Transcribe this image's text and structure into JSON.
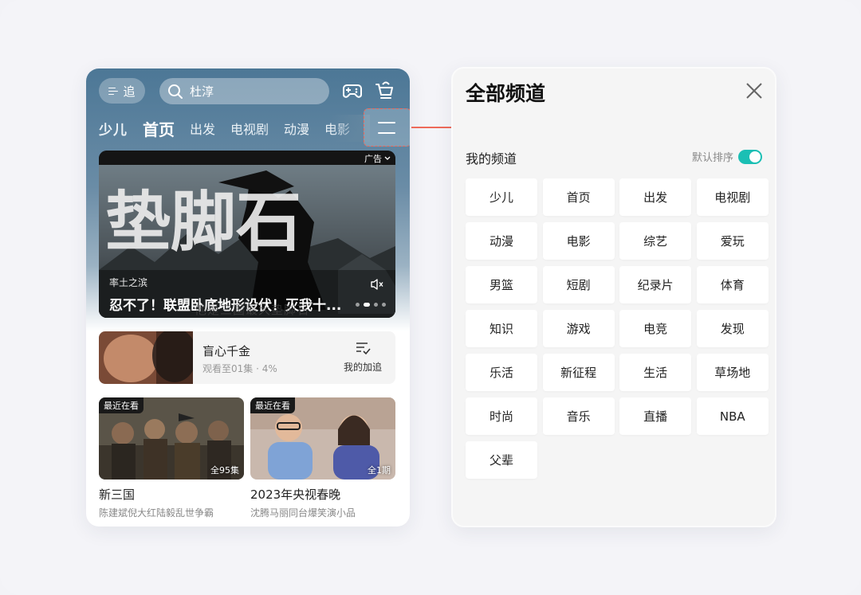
{
  "colors": {
    "accent_red": "#ee6a5a",
    "toggle_teal": "#1bbfb4",
    "header_blue": "#4c7796"
  },
  "phone": {
    "follow_label": "追",
    "search_placeholder": "杜淳",
    "icons": [
      "gamepad-icon",
      "cart-icon",
      "menu-icon",
      "search-icon"
    ],
    "tabs": [
      {
        "label": "少儿",
        "active": false
      },
      {
        "label": "首页",
        "active": true
      },
      {
        "label": "出发",
        "active": false
      },
      {
        "label": "电视剧",
        "active": false
      },
      {
        "label": "动漫",
        "active": false
      },
      {
        "label": "电影",
        "active": false
      }
    ],
    "banner": {
      "ad_label": "广告",
      "calligraphy": "垫脚石",
      "subtitle": "率土之滨",
      "title": "忍不了！联盟卧底地形设伏！灭我十...",
      "caption": "他是三国最大垫脚石"
    },
    "continue_watching": {
      "title": "盲心千金",
      "meta": "观看至01集 · 4%",
      "progress_percent": 4,
      "fav_label": "我的加追"
    },
    "cards": [
      {
        "tag": "最近在看",
        "episodes": "全95集",
        "title": "新三国",
        "subtitle": "陈建斌倪大红陆毅乱世争霸"
      },
      {
        "tag": "最近在看",
        "episodes": "全1期",
        "title": "2023年央视春晚",
        "subtitle": "沈腾马丽同台爆笑演小品"
      }
    ]
  },
  "panel": {
    "title": "全部频道",
    "section_label": "我的频道",
    "sort_label": "默认排序",
    "sort_enabled": true,
    "channels": [
      "少儿",
      "首页",
      "出发",
      "电视剧",
      "动漫",
      "电影",
      "综艺",
      "爱玩",
      "男篮",
      "短剧",
      "纪录片",
      "体育",
      "知识",
      "游戏",
      "电竞",
      "发现",
      "乐活",
      "新征程",
      "生活",
      "草场地",
      "时尚",
      "音乐",
      "直播",
      "NBA",
      "父辈"
    ]
  }
}
